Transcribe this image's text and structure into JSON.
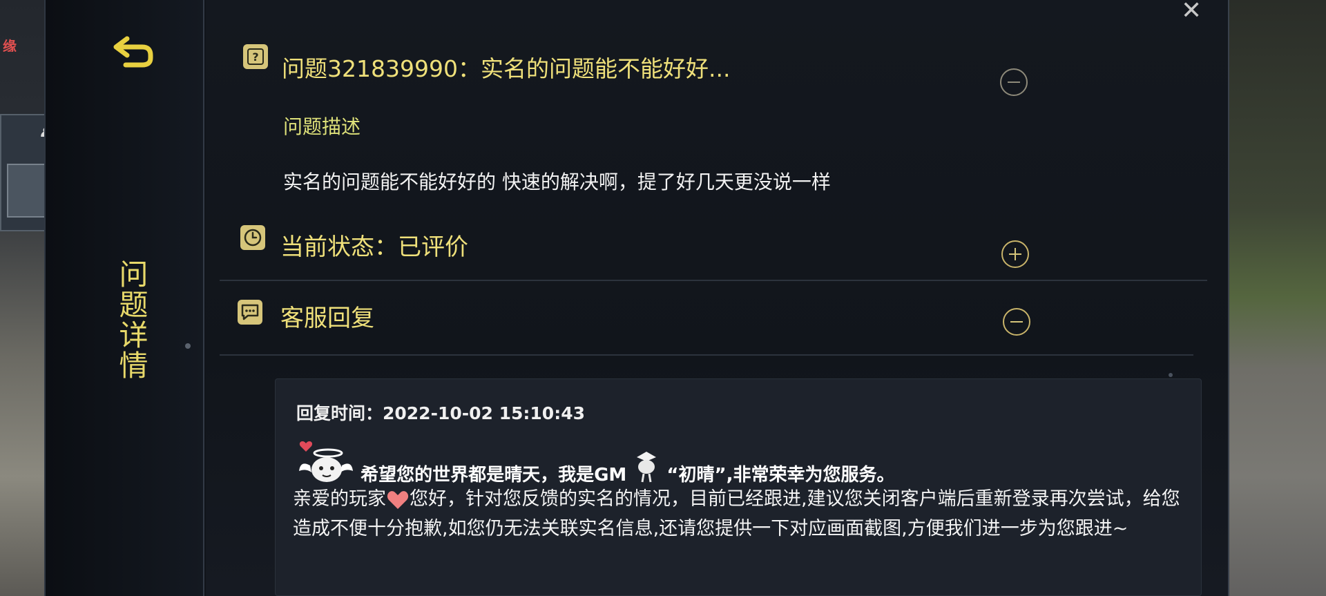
{
  "background": {
    "left_tag": "缘"
  },
  "sidebar": {
    "title": "问题详情",
    "back_icon": "back-arrow-icon"
  },
  "question": {
    "title": "问题321839990：实名的问题能不能好好...",
    "description_label": "问题描述",
    "description_text": "实名的问题能不能好好的 快速的解决啊，提了好几天更没说一样",
    "icon": "question-mark-icon"
  },
  "status": {
    "text": "当前状态：已评价",
    "icon": "clock-icon"
  },
  "reply": {
    "header": "客服回复",
    "icon": "chat-bubble-icon",
    "time": "回复时间：2022-10-02 15:10:43",
    "greeting_before_gm": "希望您的世界都是晴天，我是GM",
    "greeting_after_gm": "“初晴”,非常荣幸为您服务。",
    "body_before_heart": "亲爱的玩家",
    "body_after_heart": "您好，针对您反馈的实名的情况，目前已经跟进,建议您关闭客户端后重新登录再次尝试，给您造成不便十分抱歉,如您仍无法关联实名信息,还请您提供一下对应画面截图,方便我们进一步为您跟进~"
  },
  "colors": {
    "accent_yellow": "#efe07a",
    "panel_bg": "#11151b",
    "reply_bg": "#1d222b"
  }
}
